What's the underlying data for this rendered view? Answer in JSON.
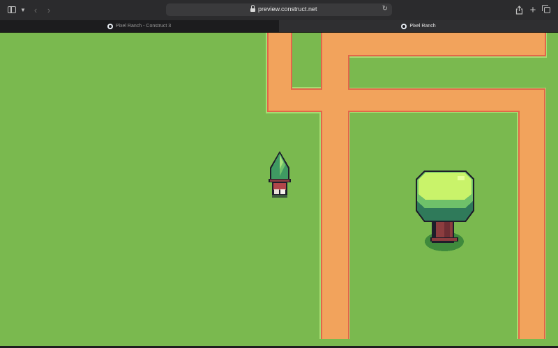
{
  "browser": {
    "url": "preview.construct.net",
    "tabs": [
      {
        "label": "Pixel Ranch - Construct 3",
        "active": false
      },
      {
        "label": "Pixel Ranch",
        "active": true
      }
    ]
  },
  "game": {
    "palette": {
      "grass": "#7ab94f",
      "path": "#f2a35c",
      "path_edge": "#e2664a",
      "grass_edge": "#a7dc72",
      "tree_light": "#c9f36a",
      "tree_mid": "#6fc16a",
      "tree_dark": "#2f7a5a",
      "trunk": "#8c3d3f",
      "outline": "#1e1e2a"
    },
    "icons": [
      "sidebar-icon",
      "chevron-down-icon",
      "back-icon",
      "forward-icon",
      "lock-icon",
      "reload-icon",
      "share-icon",
      "new-tab-icon",
      "tabs-overview-icon"
    ]
  }
}
